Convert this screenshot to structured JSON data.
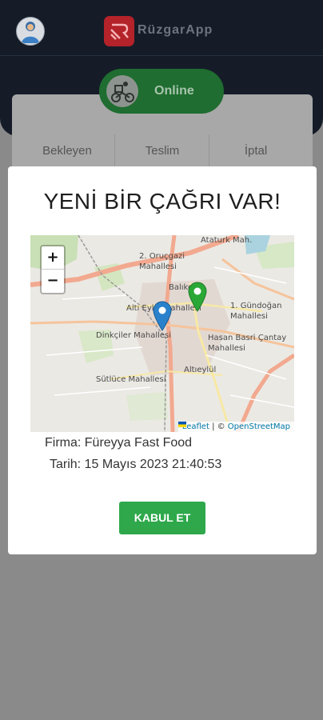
{
  "header": {
    "app_name": "RüzgarApp",
    "online_label": "Online"
  },
  "stats": {
    "tabs": [
      "Bekleyen",
      "Teslim",
      "İptal"
    ]
  },
  "modal": {
    "title": "YENİ BİR ÇAĞRI VAR!",
    "map": {
      "zoom_in": "+",
      "zoom_out": "−",
      "attribution_leaflet": "Leaflet",
      "attribution_sep": " | © ",
      "attribution_osm": "OpenStreetMap",
      "labels": [
        "Ataturk Mah.",
        "2. Oruçgazi Mahallesi",
        "Balıkesir",
        "Altı Eylül Mahallesi",
        "1. Gündoğan Mahallesi",
        "Dinkçiler Mahallesi",
        "Hasan Basri Çantay Mahallesi",
        "Altıeylül",
        "Sütlüce Mahallesi"
      ],
      "markers": [
        {
          "name": "restaurant-marker",
          "color": "#2aa836"
        },
        {
          "name": "courier-marker",
          "color": "#2a81cb"
        }
      ]
    },
    "firma_label": "Firma: Füreyya Fast Food",
    "tarih_label": "Tarih: 15 Mayıs 2023 21:40:53",
    "accept_label": "KABUL ET"
  }
}
